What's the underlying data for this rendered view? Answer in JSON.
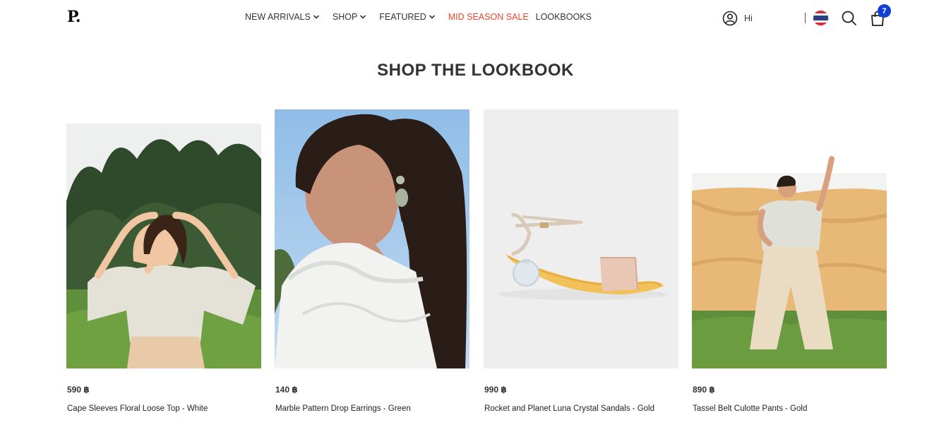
{
  "brand": {
    "logo_text": "P."
  },
  "nav": {
    "items": [
      {
        "label": "NEW ARRIVALS",
        "has_dropdown": true
      },
      {
        "label": "SHOP",
        "has_dropdown": true
      },
      {
        "label": "FEATURED",
        "has_dropdown": true
      },
      {
        "label": "MID SEASON SALE",
        "has_dropdown": false,
        "color": "#e8462a"
      },
      {
        "label": "LOOKBOOKS",
        "has_dropdown": false
      }
    ]
  },
  "account": {
    "greeting": "Hi",
    "icon": "user-circle-icon"
  },
  "locale": {
    "flag": "thailand-flag-icon"
  },
  "search": {
    "icon": "search-icon"
  },
  "cart": {
    "icon": "shopping-bag-icon",
    "count": "7",
    "badge_color": "#0d3fd6"
  },
  "page": {
    "title": "SHOP THE LOOKBOOK"
  },
  "products": [
    {
      "price": "590 ฿",
      "name": "Cape Sleeves Floral Loose Top - White"
    },
    {
      "price": "140 ฿",
      "name": "Marble Pattern Drop Earrings - Green"
    },
    {
      "price": "990 ฿",
      "name": "Rocket and Planet Luna Crystal Sandals - Gold"
    },
    {
      "price": "890 ฿",
      "name": "Tassel Belt Culotte Pants - Gold"
    }
  ]
}
